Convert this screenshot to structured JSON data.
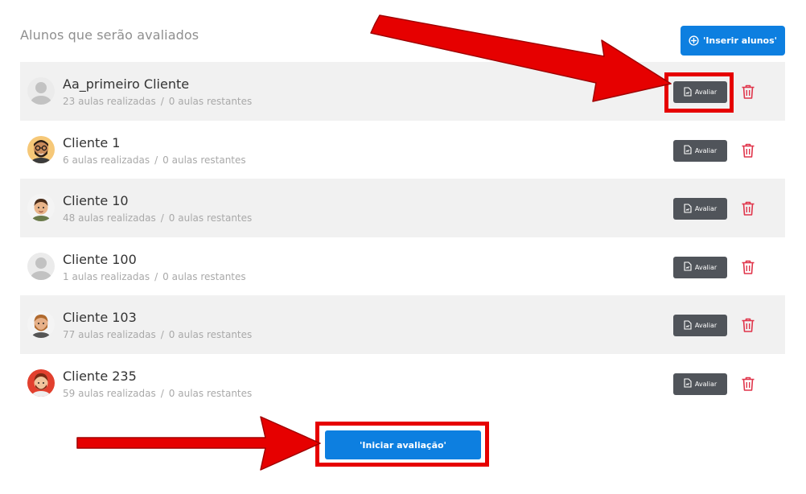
{
  "header": {
    "title": "Alunos que serão avaliados",
    "insert_button_label": "'Inserir alunos'"
  },
  "students": [
    {
      "name": "Aa_primeiro Cliente",
      "done": "23 aulas realizadas",
      "remaining": "0 aulas restantes",
      "avatar": "default-avatar",
      "eval_label": "Avaliar"
    },
    {
      "name": "Cliente 1",
      "done": "6 aulas realizadas",
      "remaining": "0 aulas restantes",
      "avatar": "bearded-man-glasses-avatar",
      "eval_label": "Avaliar"
    },
    {
      "name": "Cliente 10",
      "done": "48 aulas realizadas",
      "remaining": "0 aulas restantes",
      "avatar": "man-avatar",
      "eval_label": "Avaliar"
    },
    {
      "name": "Cliente 100",
      "done": "1 aulas realizadas",
      "remaining": "0 aulas restantes",
      "avatar": "default-avatar",
      "eval_label": "Avaliar"
    },
    {
      "name": "Cliente 103",
      "done": "77 aulas realizadas",
      "remaining": "0 aulas restantes",
      "avatar": "bearded-man-avatar",
      "eval_label": "Avaliar"
    },
    {
      "name": "Cliente 235",
      "done": "59 aulas realizadas",
      "remaining": "0 aulas restantes",
      "avatar": "red-haired-man-avatar",
      "eval_label": "Avaliar"
    }
  ],
  "meta_separator": "/",
  "footer": {
    "start_button_label": "'Iniciar avaliação'"
  },
  "colors": {
    "primary_blue": "#0d7fe0",
    "eval_button": "#50545a",
    "trash_red": "#e0344a",
    "highlight_red": "#e60000",
    "row_alt_bg": "#f1f1f1"
  }
}
